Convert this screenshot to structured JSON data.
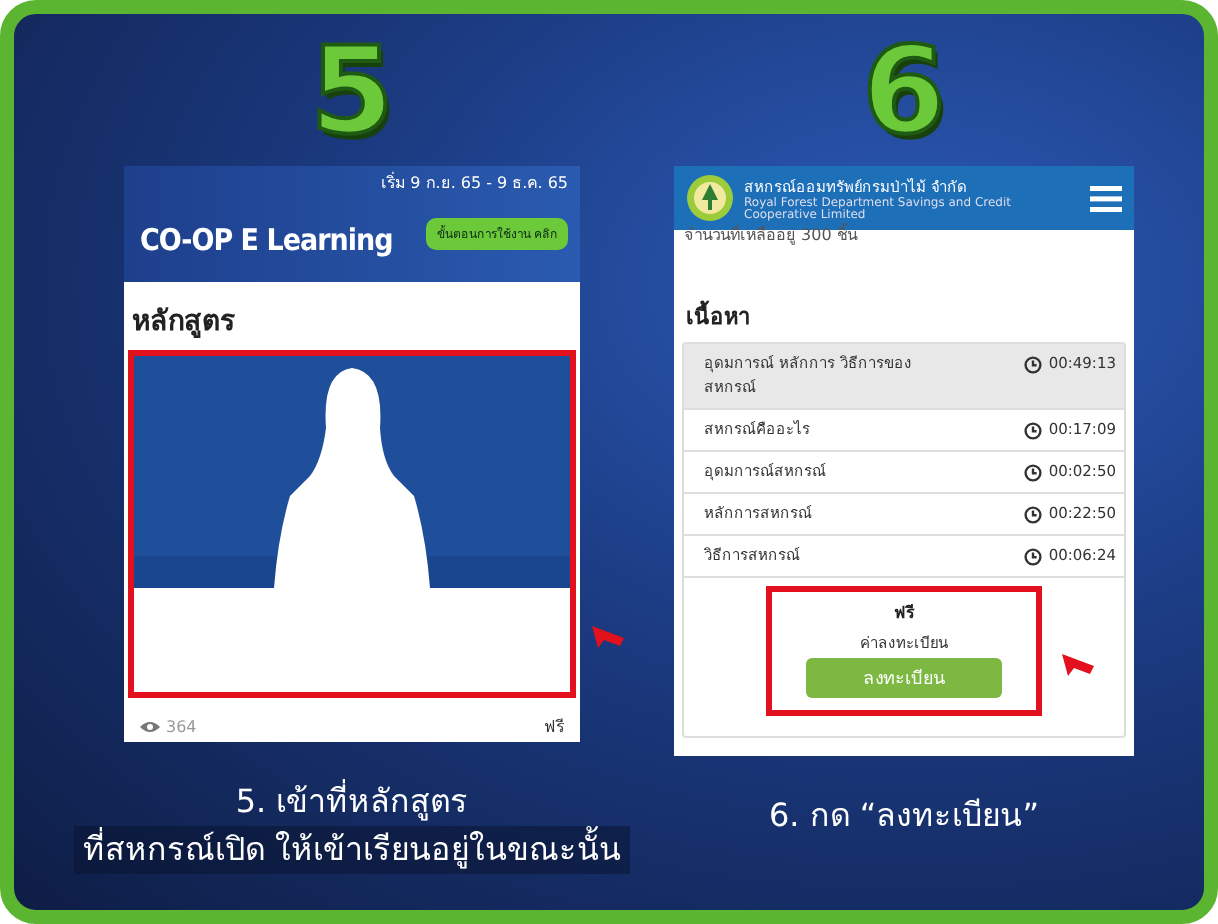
{
  "step_5": {
    "number": "5",
    "screen": {
      "banner": {
        "date": "เริ่ม 9 ก.ย. 65 - 9 ธ.ค. 65",
        "logo": "CO-OP E Learning",
        "button": "ขั้นตอนการใช้งาน คลิก"
      },
      "section_title": "หลักสูตร",
      "course_card": {
        "highlighted": true,
        "views": "364",
        "price": "ฟรี"
      }
    },
    "caption": [
      "5. เข้าที่หลักสูตร",
      "ที่สหกรณ์เปิด ให้เข้าเรียนอยู่ในขณะนั้น"
    ]
  },
  "step_6": {
    "number": "6",
    "screen": {
      "header": {
        "org_name": "สหกรณ์ออมทรัพย์กรมป่าไม้ จำกัด",
        "org_subtitle": "Royal Forest Department Savings and Credit Cooperative Limited"
      },
      "remaining": "จำนวนที่เหลืออยู่ 300 ชิ้น",
      "contents_title": "เนื้อหา",
      "lessons": [
        {
          "title": "อุดมการณ์ หลักการ วิธีการของสหกรณ์",
          "duration": "00:49:13",
          "selected": true
        },
        {
          "title": "สหกรณ์คืออะไร",
          "duration": "00:17:09",
          "selected": false
        },
        {
          "title": "อุดมการณ์สหกรณ์",
          "duration": "00:02:50",
          "selected": false
        },
        {
          "title": "หลักการสหกรณ์",
          "duration": "00:22:50",
          "selected": false
        },
        {
          "title": "วิธีการสหกรณ์",
          "duration": "00:06:24",
          "selected": false
        }
      ],
      "registration": {
        "highlighted": true,
        "price": "ฟรี",
        "price_label": "ค่าลงทะเบียน",
        "button": "ลงทะเบียน"
      }
    },
    "caption": "6. กด “ลงทะเบียน”"
  }
}
